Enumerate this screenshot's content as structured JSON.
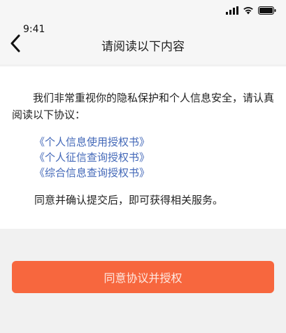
{
  "status_bar": {
    "time": "9:41",
    "signal_icon": "signal-bars-icon",
    "wifi_icon": "wifi-icon",
    "battery_icon": "battery-icon"
  },
  "nav": {
    "back_icon": "chevron-left-icon",
    "title": "请阅读以下内容"
  },
  "content": {
    "intro": "我们非常重视你的隐私保护和个人信息安全，请认真阅读以下协议：",
    "agreements": [
      "《个人信息使用授权书》",
      "《个人征信查询授权书》",
      "《综合信息查询授权书》"
    ],
    "confirm_note": "同意并确认提交后，即可获得相关服务。"
  },
  "actions": {
    "agree_button_label": "同意协议并授权"
  },
  "colors": {
    "accent_button": "#f7673e",
    "link": "#4368b8",
    "background": "#f1f1f1",
    "card": "#ffffff"
  }
}
